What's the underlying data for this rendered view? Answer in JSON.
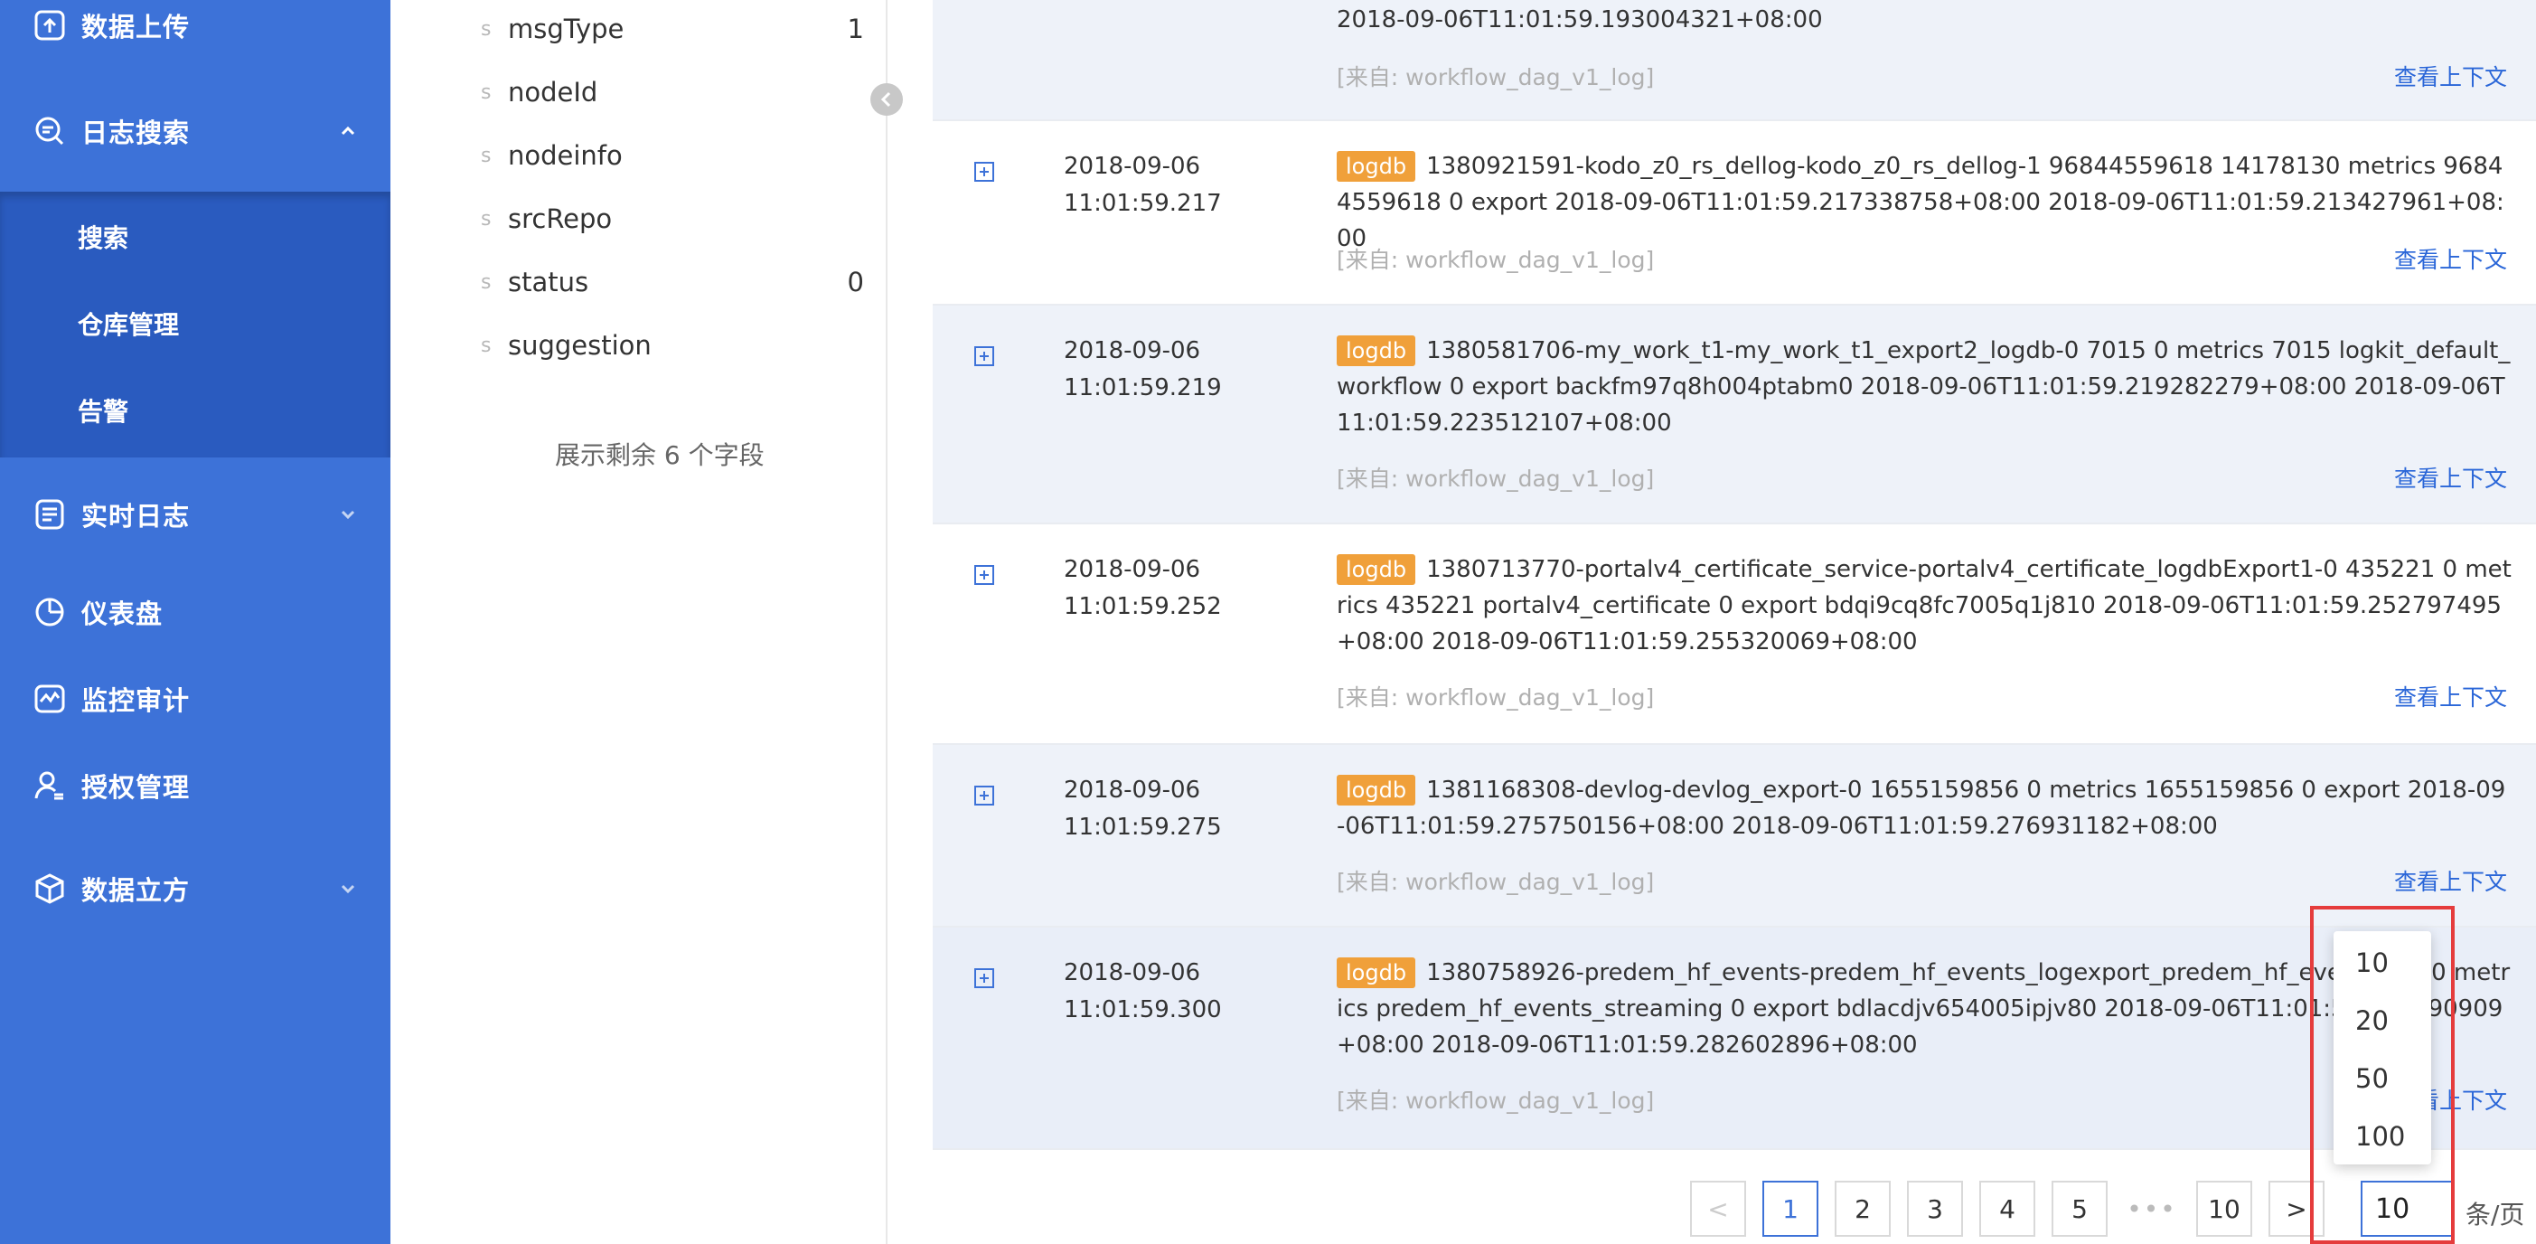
{
  "sidebar": {
    "items": [
      {
        "label": "数据上传",
        "icon": "upload-icon"
      },
      {
        "label": "日志搜索",
        "icon": "log-search-icon",
        "expanded": true
      },
      {
        "label": "实时日志",
        "icon": "realtime-log-icon"
      },
      {
        "label": "仪表盘",
        "icon": "dashboard-icon"
      },
      {
        "label": "监控审计",
        "icon": "monitor-icon"
      },
      {
        "label": "授权管理",
        "icon": "user-auth-icon"
      },
      {
        "label": "数据立方",
        "icon": "cube-icon"
      }
    ],
    "submenu": [
      "搜索",
      "仓库管理",
      "告警"
    ],
    "bg_color": "#3d72d8"
  },
  "fields": {
    "items": [
      {
        "type": "s",
        "name": "msgType",
        "count": "1"
      },
      {
        "type": "s",
        "name": "nodeId",
        "count": ""
      },
      {
        "type": "s",
        "name": "nodeinfo",
        "count": ""
      },
      {
        "type": "s",
        "name": "srcRepo",
        "count": ""
      },
      {
        "type": "s",
        "name": "status",
        "count": "0"
      },
      {
        "type": "s",
        "name": "suggestion",
        "count": ""
      }
    ],
    "show_more": "展示剩余 6 个字段"
  },
  "logs": {
    "partial_top": {
      "message_tail": "2018-09-06T11:01:59.193004321+08:00",
      "source": "[来自: workflow_dag_v1_log]",
      "context": "查看上下文"
    },
    "rows": [
      {
        "date": "2018-09-06",
        "time": "11:01:59.217",
        "tag": "logdb",
        "message": "1380921591-kodo_z0_rs_dellog-kodo_z0_rs_dellog-1  96844559618  14178130  metrics  96844559618  0  export  2018-09-06T11:01:59.217338758+08:00  2018-09-06T11:01:59.213427961+08:00",
        "source": "[来自: workflow_dag_v1_log]",
        "context": "查看上下文"
      },
      {
        "date": "2018-09-06",
        "time": "11:01:59.219",
        "tag": "logdb",
        "message": "1380581706-my_work_t1-my_work_t1_export2_logdb-0  7015  0  metrics  7015  logkit_default_workflow  0  export  backfm97q8h004ptabm0  2018-09-06T11:01:59.219282279+08:00  2018-09-06T11:01:59.223512107+08:00",
        "source": "[来自: workflow_dag_v1_log]",
        "context": "查看上下文"
      },
      {
        "date": "2018-09-06",
        "time": "11:01:59.252",
        "tag": "logdb",
        "message": "1380713770-portalv4_certificate_service-portalv4_certificate_logdbExport1-0  435221  0  metrics  435221  portalv4_certificate  0  export  bdqi9cq8fc7005q1j810  2018-09-06T11:01:59.252797495+08:00  2018-09-06T11:01:59.255320069+08:00",
        "source": "[来自: workflow_dag_v1_log]",
        "context": "查看上下文"
      },
      {
        "date": "2018-09-06",
        "time": "11:01:59.275",
        "tag": "logdb",
        "message": "1381168308-devlog-devlog_export-0  1655159856  0  metrics  1655159856  0  export  2018-09-06T11:01:59.275750156+08:00  2018-09-06T11:01:59.276931182+08:00",
        "source": "[来自: workflow_dag_v1_log]",
        "context": "查看上下文"
      },
      {
        "date": "2018-09-06",
        "time": "11:01:59.300",
        "tag": "logdb",
        "message": "1380758926-predem_hf_events-predem_hf_events_logexport_predem_hf_events-0  0  0  metrics  predem_hf_events_streaming  0  export  bdlacdjv654005ipjv80  2018-09-06T11:01:59.300390909+08:00  2018-09-06T11:01:59.282602896+08:00",
        "source": "[来自: workflow_dag_v1_log]",
        "context": "查看上下文"
      }
    ]
  },
  "pagination": {
    "prev": "<",
    "pages": [
      "1",
      "2",
      "3",
      "4",
      "5"
    ],
    "ellipsis": "•••",
    "last": "10",
    "next": ">",
    "current": "1",
    "page_size_value": "10",
    "per_page_label": "条/页",
    "size_options": [
      "10",
      "20",
      "50",
      "100"
    ]
  },
  "colors": {
    "accent": "#3d72d8",
    "tag": "#f0a03a",
    "link": "#2a66d8",
    "highlight": "#e53c3c"
  }
}
